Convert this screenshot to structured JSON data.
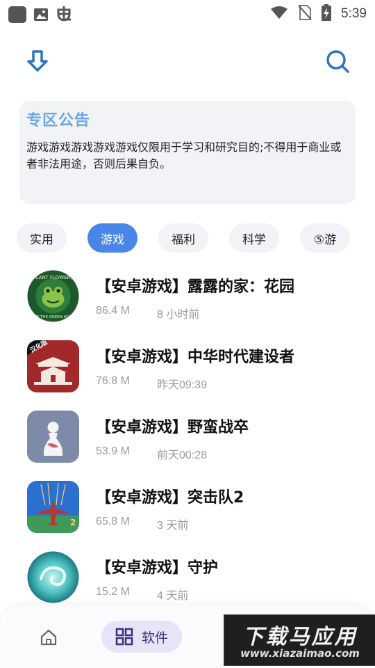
{
  "status_bar": {
    "time": "5:39",
    "left_icons": [
      "app-notification-icon",
      "image-icon",
      "bug-icon"
    ],
    "right_icons": [
      "wifi-icon",
      "no-sim-icon",
      "battery-charging-icon"
    ]
  },
  "header": {
    "left_icon": "download-icon",
    "right_icon": "search-icon",
    "accent_color": "#2f73c4"
  },
  "notice": {
    "title": "专区公告",
    "body": "游戏游戏游戏游戏游戏仅限用于学习和研究目的;不得用于商业或者非法用途，否则后果自负。"
  },
  "tabs": [
    {
      "label": "实用",
      "active": false
    },
    {
      "label": "游戏",
      "active": true
    },
    {
      "label": "福利",
      "active": false
    },
    {
      "label": "科学",
      "active": false
    },
    {
      "label": "⑤游",
      "active": false
    }
  ],
  "apps": [
    {
      "title": "【安卓游戏】露露的家：花园",
      "size": "86.4 M",
      "time": "8 小时前",
      "icon": "plant-flowers-frog-icon"
    },
    {
      "title": "【安卓游戏】中华时代建设者",
      "size": "76.8 M",
      "time": "昨天09:39",
      "icon": "chinese-palace-icon"
    },
    {
      "title": "【安卓游戏】野蛮战卒",
      "size": "53.9 M",
      "time": "前天00:28",
      "icon": "chess-pawn-icon"
    },
    {
      "title": "【安卓游戏】突击队2",
      "size": "65.8 M",
      "time": "3 天前",
      "icon": "fighter-plane-icon"
    },
    {
      "title": "【安卓游戏】守护",
      "size": "15.2 M",
      "time": "4 天前",
      "icon": "swirl-orb-icon"
    }
  ],
  "icon_text": {
    "plant_flowers_top": "PLANT FLOWERS",
    "plant_flowers_bottom": "LOVE THE GREEN HOUSE",
    "palace_badge": "汉化版"
  },
  "bottom_nav": {
    "home_icon": "home-icon",
    "software_label": "软件",
    "software_icon": "grid-icon"
  },
  "watermark": {
    "main": "下载马应用",
    "sub": "www.xiazaimao.com"
  }
}
